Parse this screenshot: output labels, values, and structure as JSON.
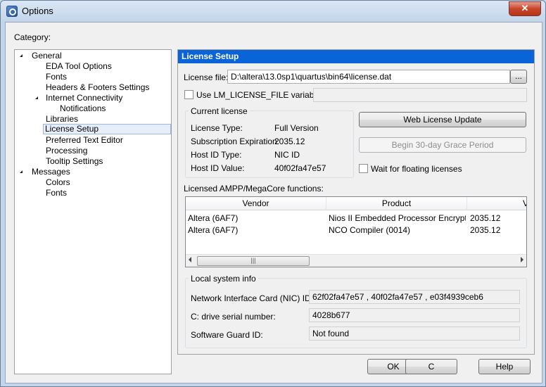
{
  "window": {
    "title": "Options",
    "close_label": "✕"
  },
  "category_label": "Category:",
  "tree": [
    {
      "label": "General",
      "expanded": true
    },
    {
      "label": "EDA Tool Options"
    },
    {
      "label": "Fonts"
    },
    {
      "label": "Headers & Footers Settings"
    },
    {
      "label": "Internet Connectivity",
      "expanded": true
    },
    {
      "label": "Notifications"
    },
    {
      "label": "Libraries"
    },
    {
      "label": "License Setup",
      "selected": true
    },
    {
      "label": "Preferred Text Editor"
    },
    {
      "label": "Processing"
    },
    {
      "label": "Tooltip Settings"
    },
    {
      "label": "Messages",
      "expanded": true
    },
    {
      "label": "Colors"
    },
    {
      "label": "Fonts"
    }
  ],
  "panel": {
    "header": "License Setup",
    "license_file_label": "License file:",
    "license_file_value": "D:\\altera\\13.0sp1\\quartus\\bin64\\license.dat",
    "browse_label": "...",
    "use_lm_label": "Use LM_LICENSE_FILE variable:",
    "use_lm_checked": false,
    "lm_value": "",
    "current_license": {
      "title": "Current license",
      "rows": [
        {
          "label": "License Type:",
          "value": "Full Version"
        },
        {
          "label": "Subscription Expiration:",
          "value": "2035.12"
        },
        {
          "label": "Host ID Type:",
          "value": "NIC ID"
        },
        {
          "label": "Host ID Value:",
          "value": "40f02fa47e57"
        }
      ]
    },
    "web_update_label": "Web License Update",
    "grace_label": "Begin 30-day Grace Period",
    "wait_floating_label": "Wait for floating licenses",
    "wait_floating_checked": false,
    "ampp_label": "Licensed AMPP/MegaCore functions:",
    "table": {
      "columns": [
        "Vendor",
        "Product",
        "V"
      ],
      "rows": [
        [
          "Altera (6AF7)",
          "Nios II Embedded Processor Encrypte...",
          "2035.12"
        ],
        [
          "Altera (6AF7)",
          "NCO Compiler (0014)",
          "2035.12"
        ]
      ],
      "scroll_grip": "|||"
    },
    "local_info": {
      "title": "Local system info",
      "nic_label": "Network Interface Card (NIC) ID:",
      "nic_value": "62f02fa47e57 , 40f02fa47e57 , e03f4939ceb6",
      "cdrive_label": "C: drive serial number:",
      "cdrive_value": "4028b677",
      "guard_label": "Software Guard ID:",
      "guard_value": "Not found"
    }
  },
  "footer": {
    "ok_label": "OK",
    "cancel_label": "C",
    "help_label": "Help"
  }
}
